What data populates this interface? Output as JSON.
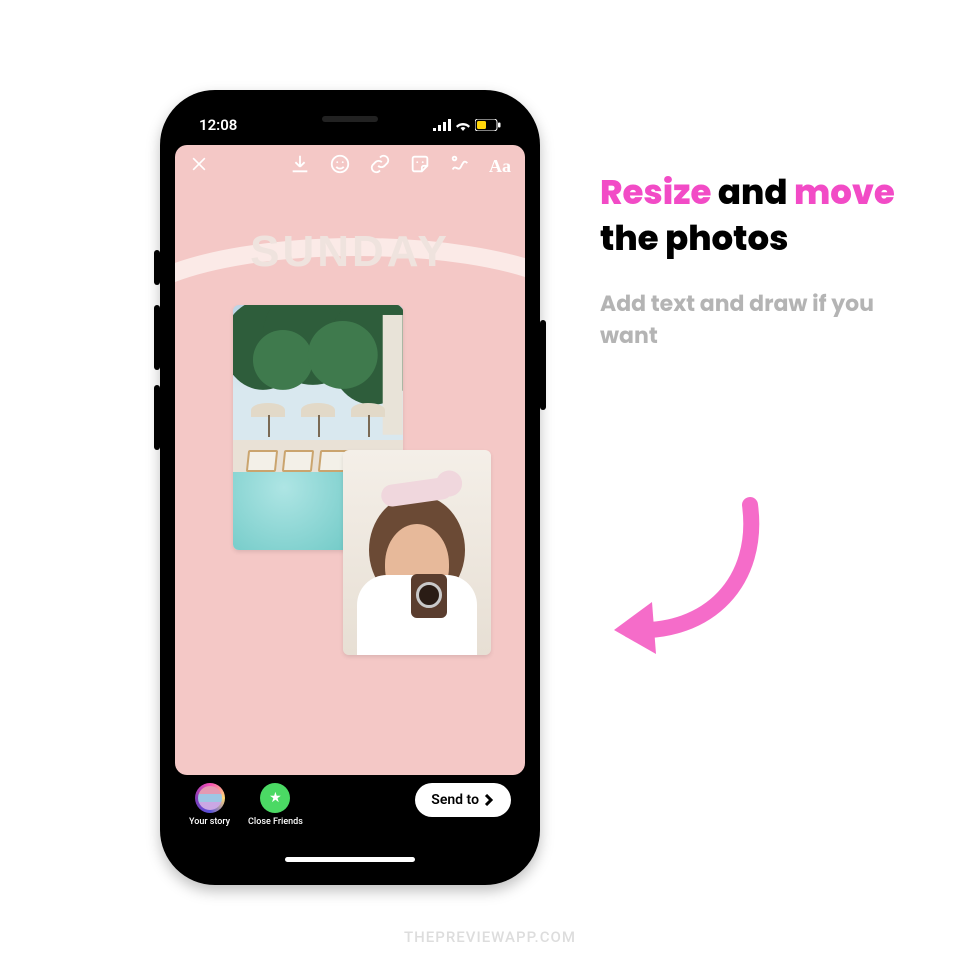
{
  "statusbar": {
    "time": "12:08"
  },
  "story": {
    "heading": "SUNDAY",
    "toolbar": {
      "text_tool": "Aa"
    }
  },
  "share": {
    "your_story": "Your story",
    "close_friends": "Close Friends",
    "send_to": "Send to"
  },
  "caption": {
    "w1": "Resize",
    "w2": "and",
    "w3": "move",
    "w4": "the",
    "w5": "photos",
    "sub": "Add text and draw if you want"
  },
  "watermark": "THEPREVIEWAPP.COM",
  "colors": {
    "pink": "#f24bc6",
    "story_bg": "#f4c8c6"
  }
}
